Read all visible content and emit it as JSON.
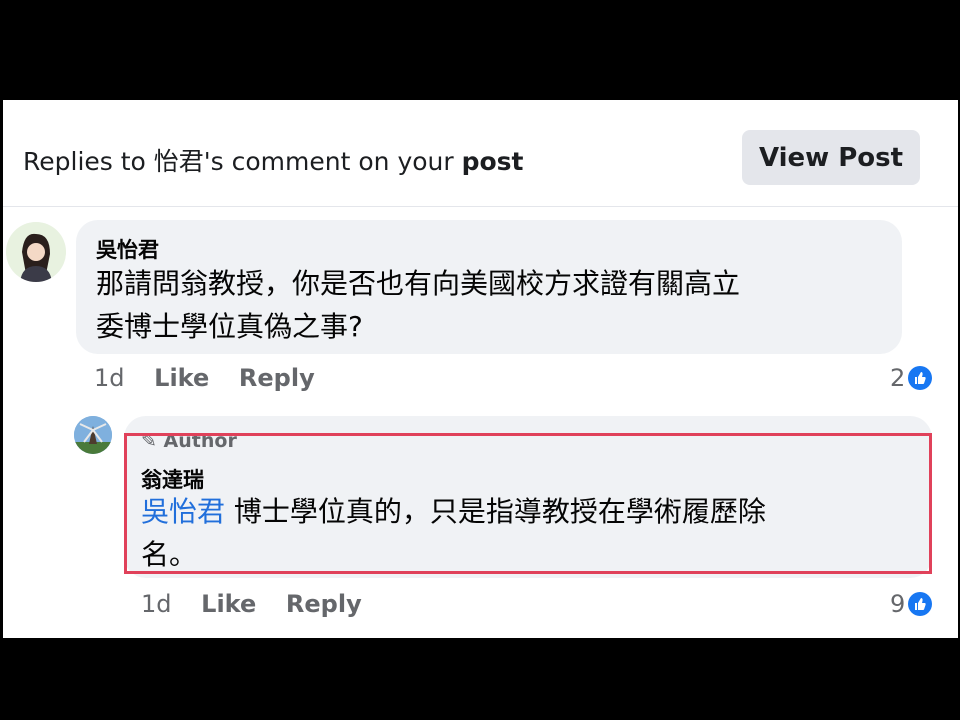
{
  "header": {
    "title_prefix": "Replies to 怡君's comment on your ",
    "title_bold": "post",
    "view_post_label": "View Post"
  },
  "comment1": {
    "name": "吳怡君",
    "text_line1": "那請問翁教授，你是否也有向美國校方求證有關高立",
    "text_line2": "委博士學位真偽之事?",
    "time": "1d",
    "like_label": "Like",
    "reply_label": "Reply",
    "reaction_count": "2"
  },
  "comment2": {
    "author_badge": "Author",
    "name": "翁達瑞",
    "mention": "吳怡君",
    "text_line1": " 博士學位真的，只是指導教授在學術履歷除",
    "text_line2": "名。",
    "time": "1d",
    "like_label": "Like",
    "reply_label": "Reply",
    "reaction_count": "9"
  },
  "colors": {
    "accent": "#1877f2",
    "mention": "#216fdb",
    "highlight": "#e0415a"
  }
}
